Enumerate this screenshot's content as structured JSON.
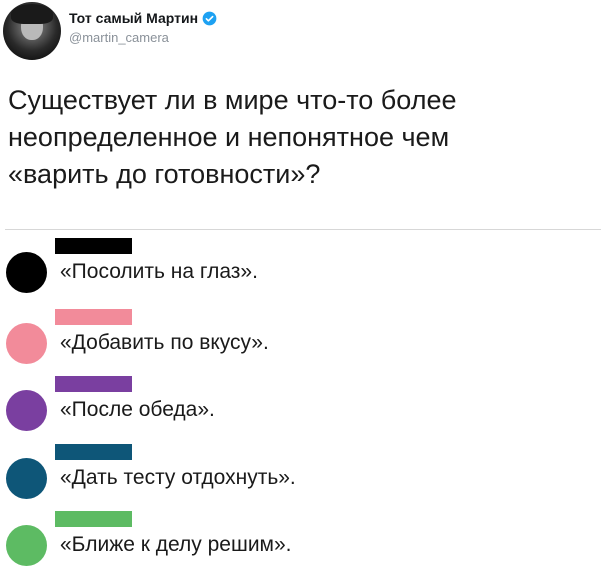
{
  "author": {
    "display_name": "Тот самый Мартин",
    "handle": "@martin_camera",
    "verified_color": "#1da1f2"
  },
  "tweet": {
    "text": "Существует ли в мире что-то более\nнеопределенное и непонятное чем\n«варить до готовности»?"
  },
  "legend": [
    {
      "label": "«Посолить на глаз».",
      "color": "#000000"
    },
    {
      "label": "«Добавить по вкусу».",
      "color": "#f28b9a"
    },
    {
      "label": "«После обеда».",
      "color": "#7a3fa0"
    },
    {
      "label": "«Дать тесту отдохнуть».",
      "color": "#0e5678"
    },
    {
      "label": "«Ближе к делу решим».",
      "color": "#5dbb63"
    }
  ]
}
